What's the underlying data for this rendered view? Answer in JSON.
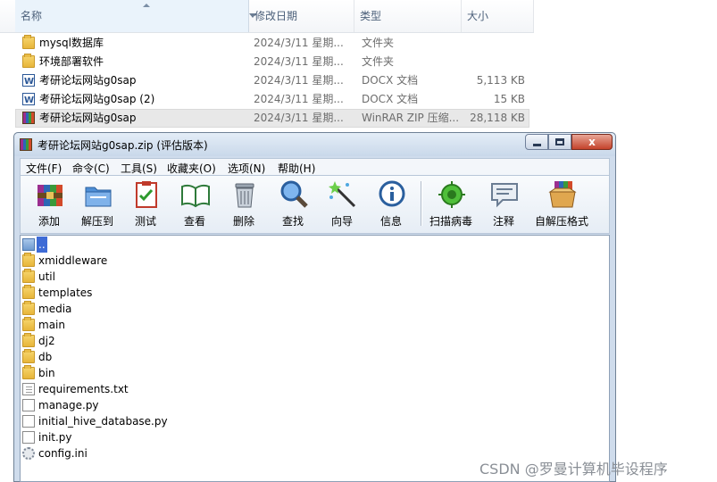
{
  "explorer": {
    "columns": {
      "name": "名称",
      "date": "修改日期",
      "type": "类型",
      "size": "大小"
    },
    "rows": [
      {
        "name": "mysql数据库",
        "date": "2024/3/11 星期...",
        "type": "文件夹",
        "size": "",
        "icon": "folder-icon"
      },
      {
        "name": "环境部署软件",
        "date": "2024/3/11 星期...",
        "type": "文件夹",
        "size": "",
        "icon": "folder-icon"
      },
      {
        "name": "考研论坛网站g0sap",
        "date": "2024/3/11 星期...",
        "type": "DOCX 文档",
        "size": "5,113 KB",
        "icon": "docx-icon"
      },
      {
        "name": "考研论坛网站g0sap (2)",
        "date": "2024/3/11 星期...",
        "type": "DOCX 文档",
        "size": "15 KB",
        "icon": "docx-icon"
      },
      {
        "name": "考研论坛网站g0sap",
        "date": "2024/3/11 星期...",
        "type": "WinRAR ZIP 压缩...",
        "size": "28,118 KB",
        "icon": "winrar-archive-icon"
      }
    ]
  },
  "winrar": {
    "title": "考研论坛网站g0sap.zip (评估版本)",
    "close_label": "x",
    "menu": [
      "文件(F)",
      "命令(C)",
      "工具(S)",
      "收藏夹(O)",
      "选项(N)",
      "帮助(H)"
    ],
    "toolbar": [
      {
        "label": "添加",
        "icon": "add-archive-icon"
      },
      {
        "label": "解压到",
        "icon": "extract-to-icon"
      },
      {
        "label": "测试",
        "icon": "test-icon"
      },
      {
        "label": "查看",
        "icon": "view-book-icon"
      },
      {
        "label": "删除",
        "icon": "trash-icon"
      },
      {
        "label": "查找",
        "icon": "magnifier-icon"
      },
      {
        "label": "向导",
        "icon": "wizard-wand-icon"
      },
      {
        "label": "信息",
        "icon": "info-icon"
      },
      {
        "label": "扫描病毒",
        "icon": "virus-scan-icon"
      },
      {
        "label": "注释",
        "icon": "comment-icon"
      },
      {
        "label": "自解压格式",
        "icon": "sfx-box-icon"
      }
    ],
    "files": [
      {
        "name": "..",
        "icon": "parent-folder-icon"
      },
      {
        "name": "xmiddleware",
        "icon": "folder-icon"
      },
      {
        "name": "util",
        "icon": "folder-icon"
      },
      {
        "name": "templates",
        "icon": "folder-icon"
      },
      {
        "name": "media",
        "icon": "folder-icon"
      },
      {
        "name": "main",
        "icon": "folder-icon"
      },
      {
        "name": "dj2",
        "icon": "folder-icon"
      },
      {
        "name": "db",
        "icon": "folder-icon"
      },
      {
        "name": "bin",
        "icon": "folder-icon"
      },
      {
        "name": "requirements.txt",
        "icon": "text-file-icon"
      },
      {
        "name": "manage.py",
        "icon": "python-file-icon"
      },
      {
        "name": "initial_hive_database.py",
        "icon": "python-file-icon"
      },
      {
        "name": "init.py",
        "icon": "python-file-icon"
      },
      {
        "name": "config.ini",
        "icon": "config-file-icon"
      }
    ]
  },
  "watermark": "CSDN @罗曼计算机毕设程序"
}
